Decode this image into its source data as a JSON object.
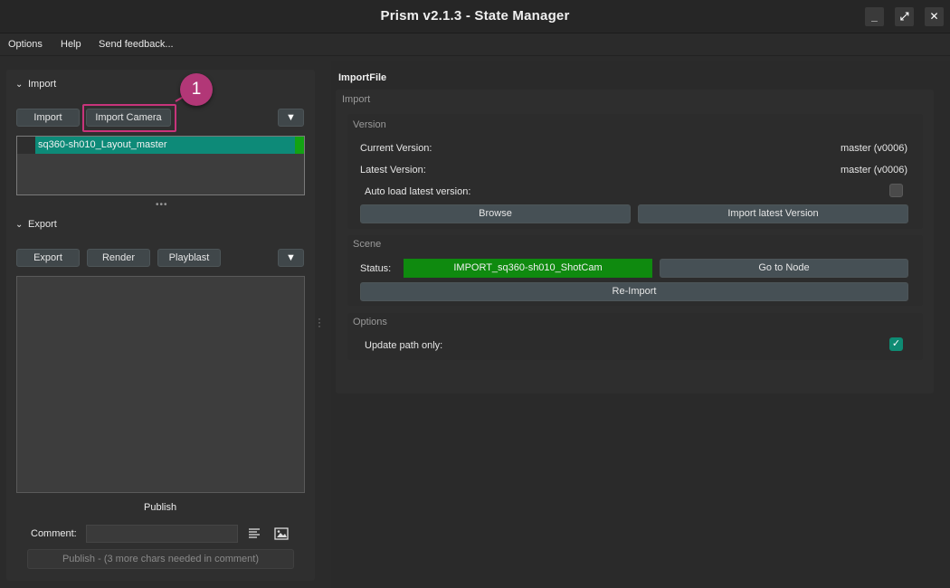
{
  "window": {
    "title": "Prism v2.1.3 - State Manager",
    "controls": {
      "minimize": "_",
      "maximize": "⤢",
      "close": "✕"
    }
  },
  "menu": [
    "Options",
    "Help",
    "Send feedback..."
  ],
  "import_section": {
    "header": "Import",
    "buttons": {
      "import": "Import",
      "import_camera": "Import Camera",
      "dropdown": "▼"
    },
    "items": [
      {
        "label": "sq360-sh010_Layout_master"
      }
    ]
  },
  "export_section": {
    "header": "Export",
    "buttons": {
      "export": "Export",
      "render": "Render",
      "playblast": "Playblast",
      "dropdown": "▼"
    }
  },
  "publish": {
    "title": "Publish",
    "comment_label": "Comment:",
    "comment_value": "",
    "button": "Publish - (3 more chars needed in comment)"
  },
  "annotation": {
    "badge": "1"
  },
  "state": {
    "title": "ImportFile",
    "import_group_title": "Import",
    "version_group": {
      "title": "Version",
      "current_label": "Current Version:",
      "current_value": "master (v0006)",
      "latest_label": "Latest Version:",
      "latest_value": "master (v0006)",
      "autoload_label": "Auto load latest version:",
      "autoload_checked": false,
      "browse": "Browse",
      "import_latest": "Import latest Version"
    },
    "scene_group": {
      "title": "Scene",
      "status_label": "Status:",
      "status_value": "IMPORT_sq360-sh010_ShotCam",
      "status_color": "#0f8a0f",
      "goto": "Go to Node",
      "reimport": "Re-Import"
    },
    "options_group": {
      "title": "Options",
      "update_path_label": "Update path only:",
      "update_path_checked": true
    }
  },
  "colors": {
    "accent": "#0e8b73",
    "highlight": "#c8347b"
  }
}
